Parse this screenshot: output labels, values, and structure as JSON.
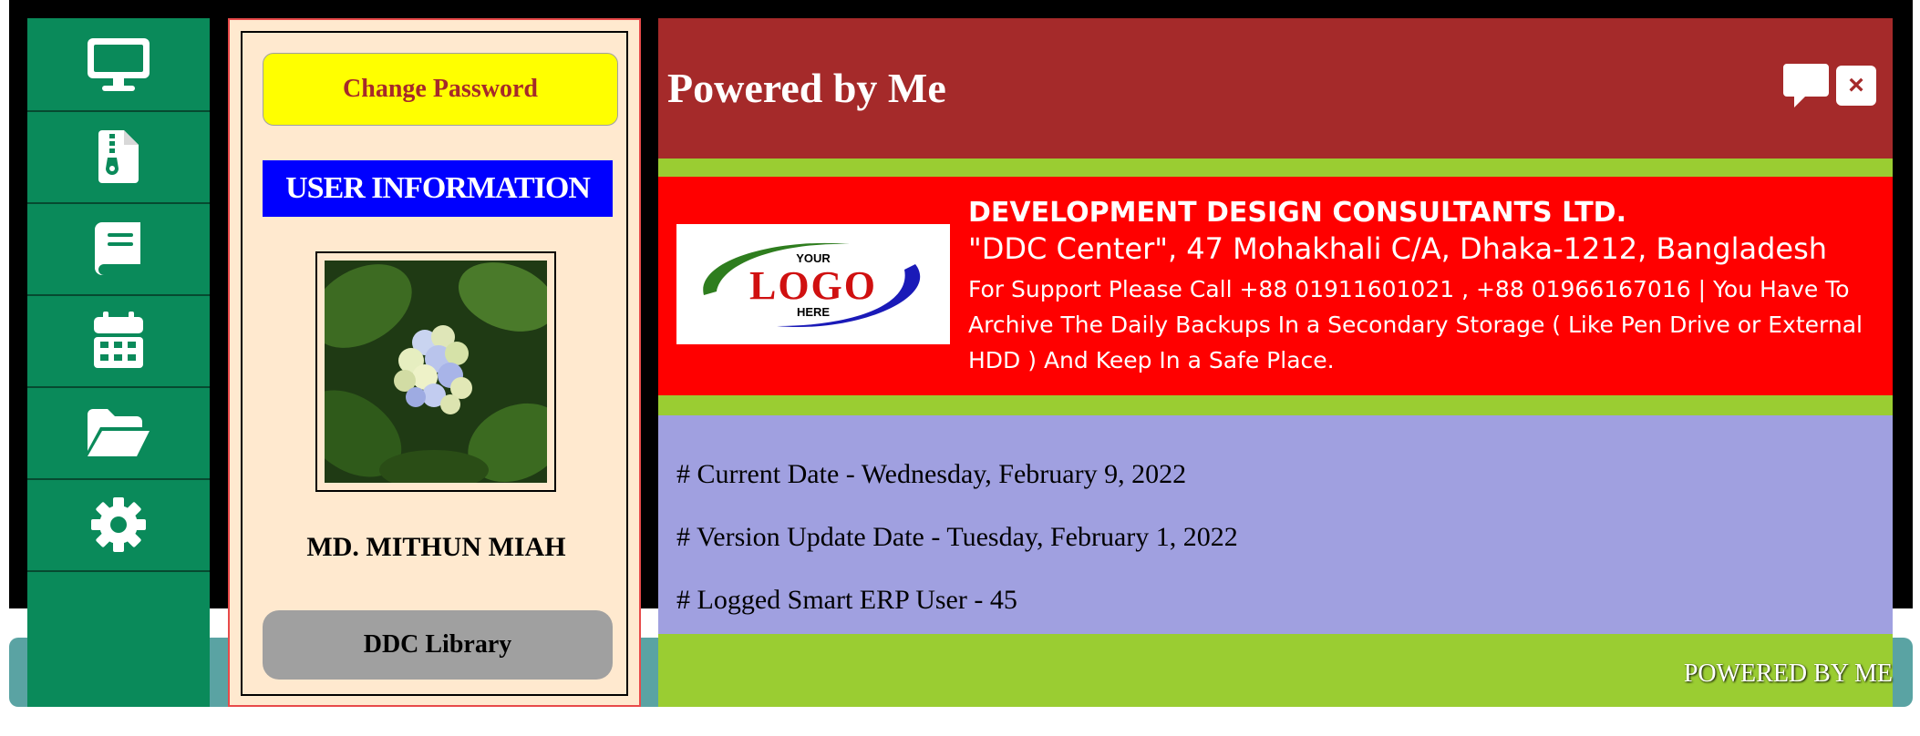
{
  "sidebar": {
    "items": [
      {
        "icon": "desktop-icon"
      },
      {
        "icon": "file-zip-icon"
      },
      {
        "icon": "book-icon"
      },
      {
        "icon": "calendar-icon"
      },
      {
        "icon": "folder-open-icon"
      },
      {
        "icon": "gear-icon"
      }
    ]
  },
  "user_panel": {
    "change_password_label": "Change Password",
    "heading": "USER INFORMATION",
    "user_name": "MD. MITHUN MIAH",
    "library_button_label": "DDC Library"
  },
  "header": {
    "title": "Powered by Me",
    "close_label": "×"
  },
  "company": {
    "logo": {
      "small_top": "YOUR",
      "main": "LOGO",
      "small_bottom": "HERE"
    },
    "name": "DEVELOPMENT DESIGN CONSULTANTS LTD.",
    "address": "\"DDC Center\", 47 Mohakhali C/A, Dhaka-1212, Bangladesh",
    "support": "For Support Please Call +88 01911601021 , +88 01966167016 | You Have To Archive The Daily Backups In a Secondary Storage ( Like Pen Drive or External HDD ) And Keep In a Safe Place."
  },
  "info": {
    "current_date": "# Current Date - Wednesday, February 9, 2022",
    "version_update_date": "# Version Update Date - Tuesday, February 1, 2022",
    "logged_users": "# Logged Smart ERP User - 45"
  },
  "footer": {
    "text": "POWERED BY ME"
  },
  "colors": {
    "sidebar": "#0a8a5a",
    "header": "#a52a2a",
    "banner": "#ff0000",
    "accent_green": "#9acd32",
    "info_bg": "#a0a0e0",
    "user_heading": "#0000ff",
    "change_password_bg": "#ffff00"
  }
}
